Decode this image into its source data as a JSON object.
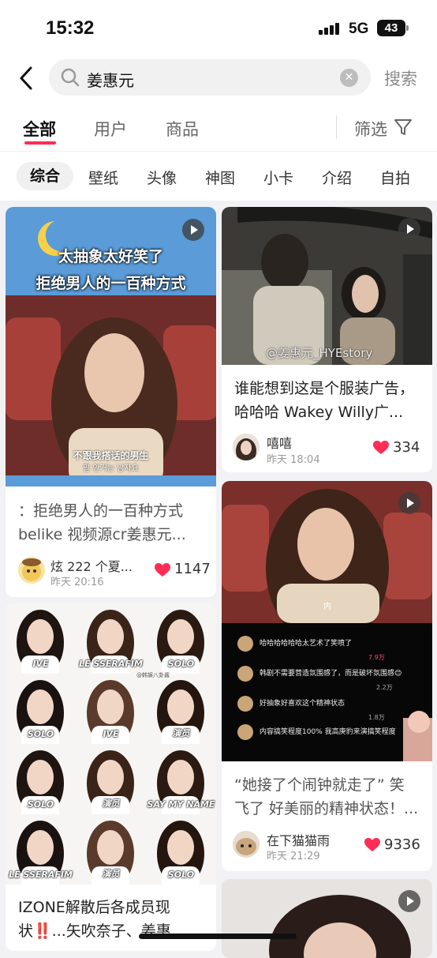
{
  "status": {
    "time": "15:32",
    "network": "5G",
    "battery": "43"
  },
  "search": {
    "query": "姜惠元",
    "button": "搜索"
  },
  "tabs": {
    "all": "全部",
    "users": "用户",
    "products": "商品",
    "filter": "筛选"
  },
  "categories": [
    "综合",
    "壁纸",
    "头像",
    "神图",
    "小卡",
    "介绍",
    "自拍"
  ],
  "colors": {
    "accent": "#ff2d55",
    "like": "#ff2d55"
  },
  "cards": [
    {
      "overlay_top": "太抽象太好笑了",
      "overlay_main": "拒绝男人的一百种方式",
      "subtitle_cn": "不跟我搭话的男生",
      "subtitle_kr": "말 안거는 남자요",
      "title_line1": "：拒绝男人的一百种方式",
      "title_line2": "belike 视频源cr姜惠元...",
      "author": "炫 222 个夏...",
      "date": "昨天 20:16",
      "likes": "1147"
    },
    {
      "watermark": "@姜惠元_HYEstory",
      "title_line1": "谁能想到这是个服装广告，",
      "title_line2": "哈哈哈 Wakey Willy广...",
      "author": "嘻嘻",
      "date": "昨天 18:04",
      "likes": "334"
    },
    {
      "caption": "内",
      "comments": [
        {
          "text": "哈哈哈哈哈哈太艺术了笑喷了",
          "likes": "7.9万"
        },
        {
          "text": "韩剧不需要营造氛围感了，而是破坏氛围感😊",
          "likes": "2.2万"
        },
        {
          "text": "好抽象好喜欢这个精神状态",
          "likes": "1.8万"
        },
        {
          "text": "内容搞笑程度100% 我高庚豹来演搞笑程度",
          "likes": ""
        }
      ],
      "title_line1": "“她接了个闹钟就走了” 笑",
      "title_line2": "飞了 好美丽的精神状态！...",
      "author": "在下猫猫雨",
      "date": "昨天 21:29",
      "likes": "9336"
    },
    {
      "grid_labels": [
        "IVE",
        "LE SSERAFIM",
        "SOLO",
        "SOLO",
        "IVE",
        "演员",
        "SOLO",
        "演员",
        "SAY MY NAME",
        "LE SSERAFIM",
        "演员",
        "SOLO"
      ],
      "grid_credit": "@韩娱八卦酱",
      "title_line1": "IZONE解散后各成员现",
      "title_line2": "状‼️...矢吹奈子、姜惠"
    }
  ]
}
